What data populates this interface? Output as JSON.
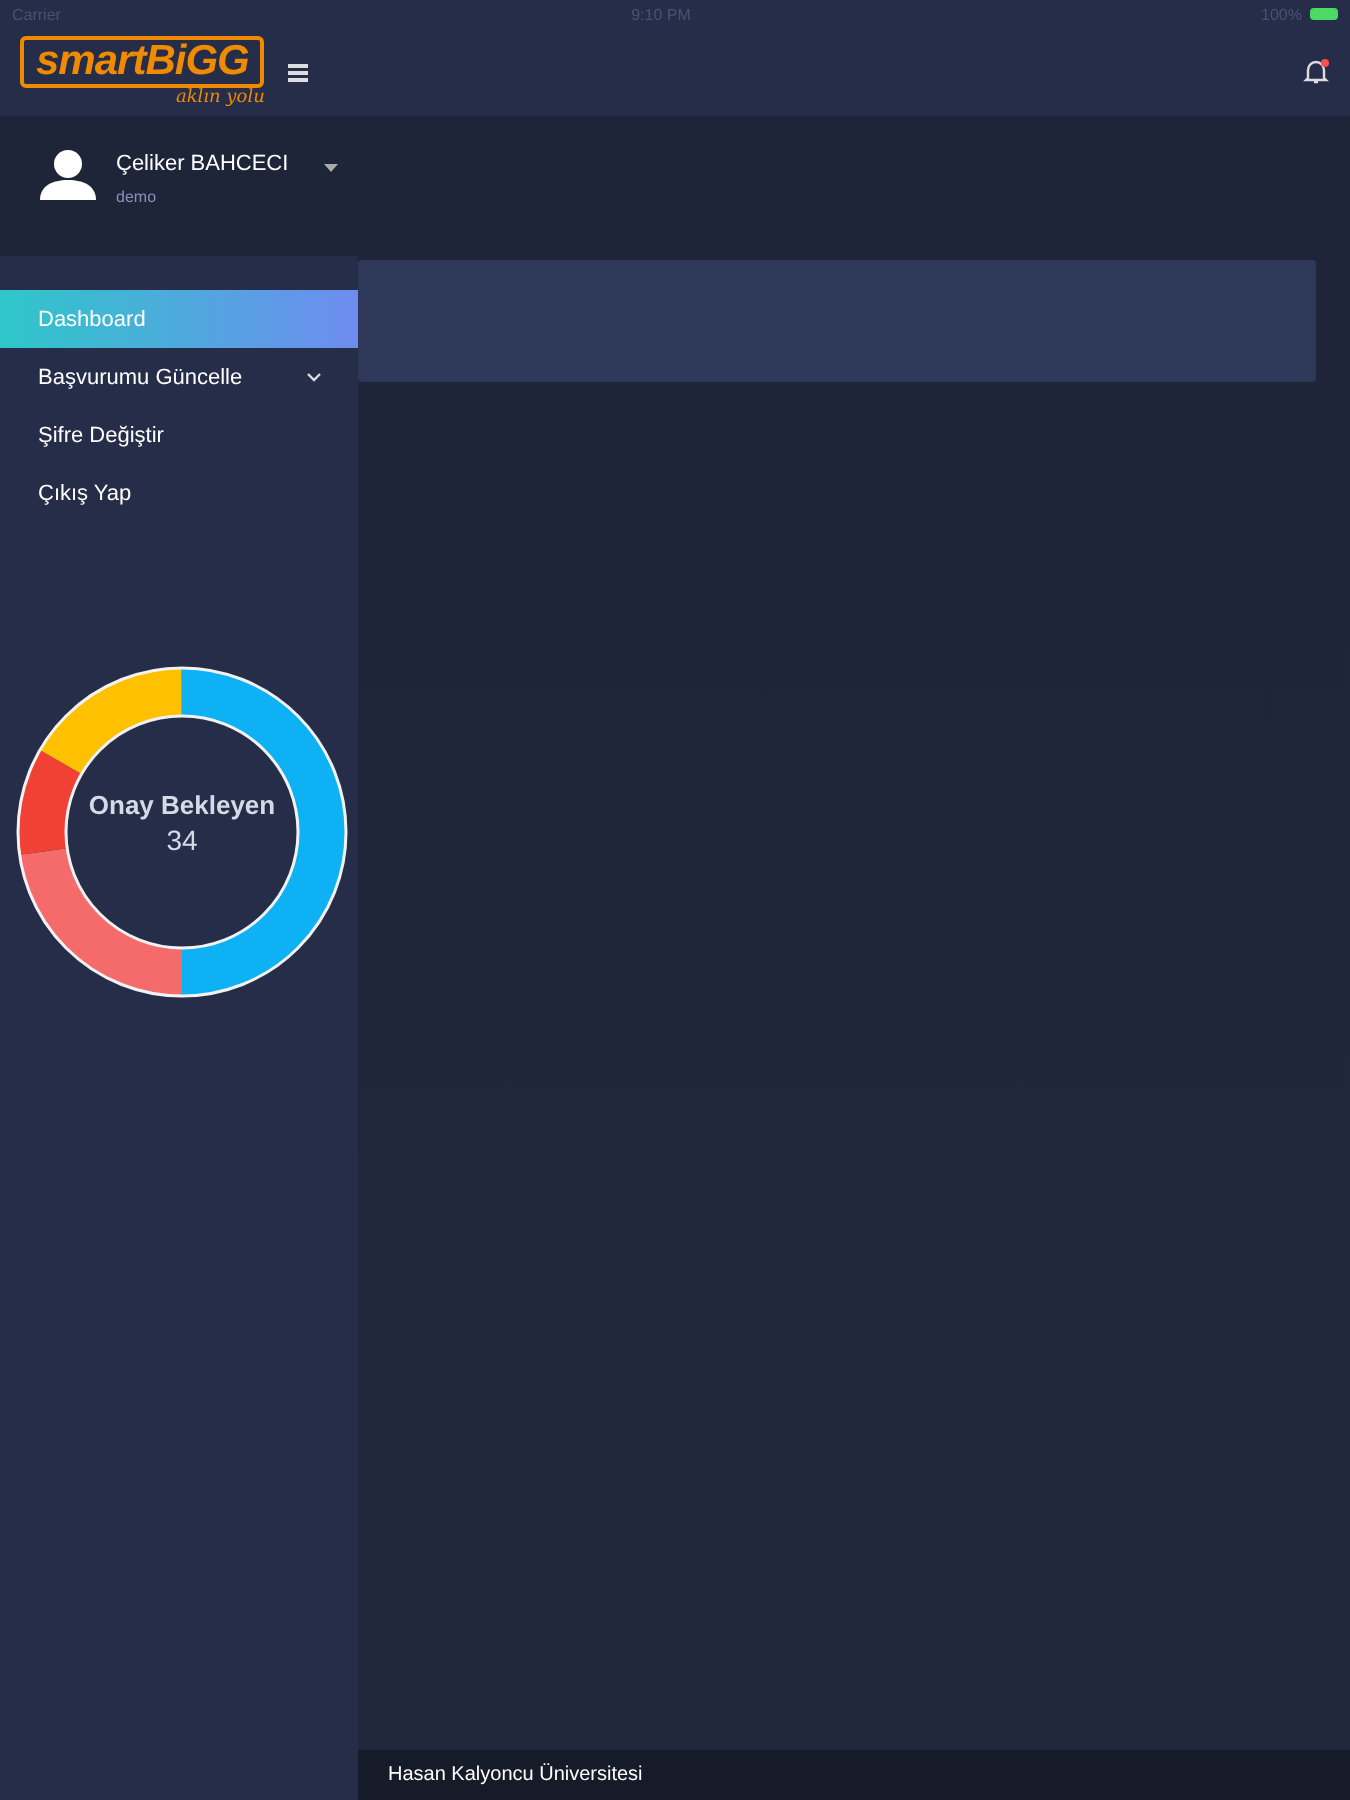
{
  "status_bar": {
    "carrier": "Carrier",
    "time": "9:10 PM",
    "battery": "100%"
  },
  "header": {
    "logo": "smartBiGG",
    "tagline": "aklın yolu",
    "notification": true
  },
  "user": {
    "name": "Çeliker BAHCECI",
    "role": "demo"
  },
  "menu": [
    {
      "label": "Dashboard",
      "selected": true,
      "expandable": false
    },
    {
      "label": "Başvurumu Güncelle",
      "selected": false,
      "expandable": true
    },
    {
      "label": "Şifre Değiştir",
      "selected": false,
      "expandable": false
    },
    {
      "label": "Çıkış Yap",
      "selected": false,
      "expandable": false
    }
  ],
  "donut": {
    "label": "Onay Bekleyen",
    "value": "34"
  },
  "footer": "Hasan Kalyoncu Üniversitesi"
}
